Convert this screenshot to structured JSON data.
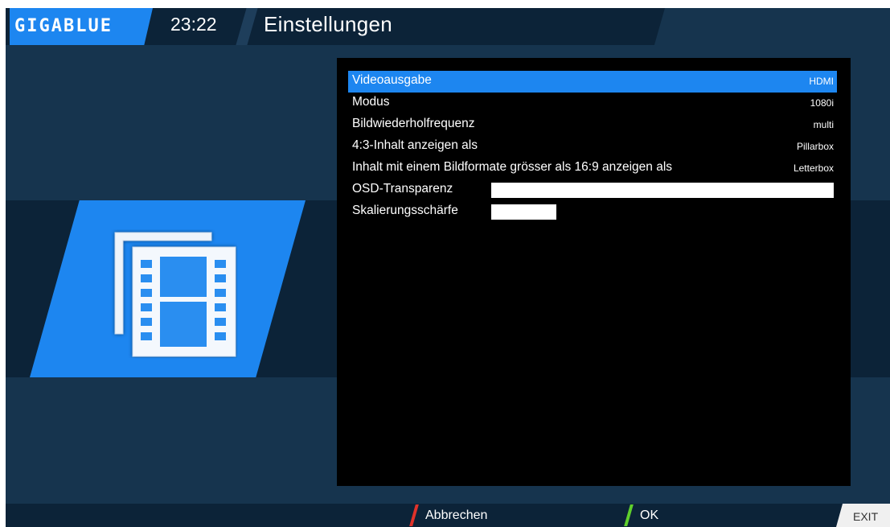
{
  "header": {
    "logo_text": "GIGABLUE",
    "time": "23:22",
    "title": "Einstellungen"
  },
  "icon": {
    "name": "film-settings-icon"
  },
  "settings": {
    "items": [
      {
        "label": "Videoausgabe",
        "value": "HDMI",
        "selected": true
      },
      {
        "label": "Modus",
        "value": "1080i",
        "selected": false
      },
      {
        "label": "Bildwiederholfrequenz",
        "value": "multi",
        "selected": false
      },
      {
        "label": "4:3-Inhalt anzeigen als",
        "value": "Pillarbox",
        "selected": false
      },
      {
        "label": "Inhalt mit einem Bildformate grösser als 16:9 anzeigen als",
        "value": "Letterbox",
        "selected": false
      }
    ],
    "sliders": [
      {
        "label": "OSD-Transparenz",
        "level": 1.0
      },
      {
        "label": "Skalierungsschärfe",
        "level": 0.19
      }
    ]
  },
  "footer": {
    "red_label": "Abbrechen",
    "green_label": "OK",
    "exit_label": "EXIT"
  },
  "colors": {
    "accent": "#1d86f0",
    "background": "#16344e",
    "panel": "#000000",
    "red": "#e0322a",
    "green": "#5fcf2c"
  }
}
